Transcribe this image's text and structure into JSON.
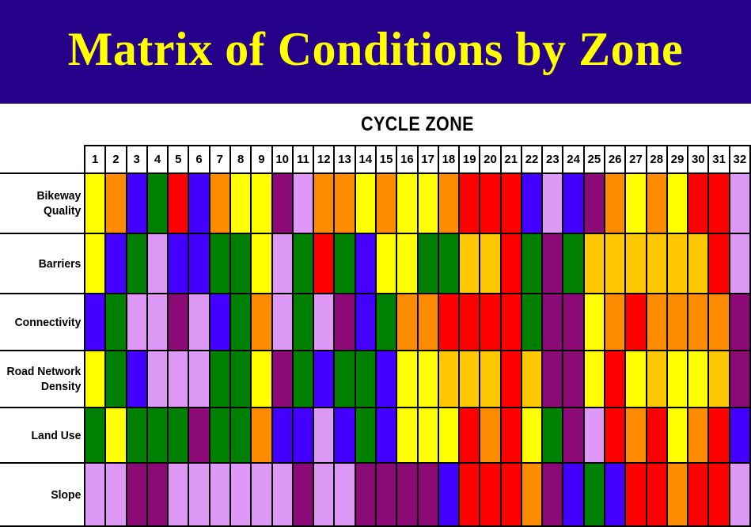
{
  "title": "Matrix of Conditions by Zone",
  "chart_header": "CYCLE ZONE",
  "colors": {
    "banner_background": "#250089",
    "title_text": "#FFFF00",
    "grid_line": "#000000",
    "page_background": "#FFFFFF",
    "palette": {
      "yellow": "#FFFF00",
      "gold": "#FFC800",
      "orange": "#FF8C00",
      "red": "#FF0000",
      "green": "#008000",
      "blue": "#4400FF",
      "purple": "#8B0A76",
      "lavender": "#DD99F5"
    }
  },
  "chart_data": {
    "type": "heatmap",
    "title": "Matrix of Conditions by Zone",
    "xlabel": "CYCLE ZONE",
    "ylabel": "",
    "legend_position": "none",
    "grid": true,
    "categories": [
      "1",
      "2",
      "3",
      "4",
      "5",
      "6",
      "7",
      "8",
      "9",
      "10",
      "11",
      "12",
      "13",
      "14",
      "15",
      "16",
      "17",
      "18",
      "19",
      "20",
      "21",
      "22",
      "23",
      "24",
      "25",
      "26",
      "27",
      "28",
      "29",
      "30",
      "31",
      "32"
    ],
    "rows": [
      {
        "label": "Bikeway Quality",
        "label_lines": [
          "Bikeway",
          "Quality"
        ],
        "values": [
          "yellow",
          "orange",
          "blue",
          "green",
          "red",
          "blue",
          "orange",
          "yellow",
          "yellow",
          "purple",
          "lavender",
          "orange",
          "orange",
          "yellow",
          "orange",
          "yellow",
          "yellow",
          "orange",
          "red",
          "red",
          "red",
          "blue",
          "lavender",
          "blue",
          "purple",
          "orange",
          "yellow",
          "orange",
          "yellow",
          "red",
          "red",
          "lavender"
        ]
      },
      {
        "label": "Barriers",
        "label_lines": [
          "Barriers"
        ],
        "values": [
          "yellow",
          "blue",
          "green",
          "lavender",
          "blue",
          "blue",
          "green",
          "green",
          "yellow",
          "lavender",
          "green",
          "red",
          "green",
          "blue",
          "yellow",
          "yellow",
          "green",
          "green",
          "gold",
          "gold",
          "red",
          "green",
          "purple",
          "green",
          "gold",
          "gold",
          "gold",
          "gold",
          "gold",
          "gold",
          "red",
          "lavender"
        ]
      },
      {
        "label": "Connectivity",
        "label_lines": [
          "Connectivity"
        ],
        "values": [
          "blue",
          "green",
          "lavender",
          "lavender",
          "purple",
          "lavender",
          "blue",
          "green",
          "orange",
          "lavender",
          "green",
          "lavender",
          "purple",
          "blue",
          "green",
          "orange",
          "orange",
          "red",
          "red",
          "red",
          "red",
          "green",
          "purple",
          "purple",
          "yellow",
          "orange",
          "red",
          "orange",
          "orange",
          "orange",
          "orange",
          "purple"
        ]
      },
      {
        "label": "Road Network Density",
        "label_lines": [
          "Road Network",
          "Density"
        ],
        "values": [
          "yellow",
          "green",
          "blue",
          "lavender",
          "lavender",
          "lavender",
          "green",
          "green",
          "yellow",
          "purple",
          "green",
          "blue",
          "green",
          "green",
          "blue",
          "yellow",
          "yellow",
          "gold",
          "gold",
          "gold",
          "red",
          "gold",
          "purple",
          "purple",
          "yellow",
          "red",
          "yellow",
          "gold",
          "yellow",
          "yellow",
          "gold",
          "purple"
        ]
      },
      {
        "label": "Land Use",
        "label_lines": [
          "Land Use"
        ],
        "values": [
          "green",
          "yellow",
          "green",
          "green",
          "green",
          "purple",
          "green",
          "green",
          "orange",
          "blue",
          "blue",
          "lavender",
          "blue",
          "green",
          "blue",
          "yellow",
          "yellow",
          "yellow",
          "red",
          "orange",
          "red",
          "yellow",
          "green",
          "purple",
          "lavender",
          "red",
          "orange",
          "red",
          "yellow",
          "orange",
          "red",
          "blue"
        ]
      },
      {
        "label": "Slope",
        "label_lines": [
          "Slope"
        ],
        "values": [
          "lavender",
          "lavender",
          "purple",
          "purple",
          "lavender",
          "lavender",
          "lavender",
          "lavender",
          "lavender",
          "lavender",
          "purple",
          "lavender",
          "lavender",
          "purple",
          "purple",
          "purple",
          "purple",
          "blue",
          "red",
          "red",
          "red",
          "orange",
          "purple",
          "blue",
          "green",
          "blue",
          "red",
          "red",
          "orange",
          "red",
          "red",
          "lavender"
        ]
      }
    ]
  }
}
